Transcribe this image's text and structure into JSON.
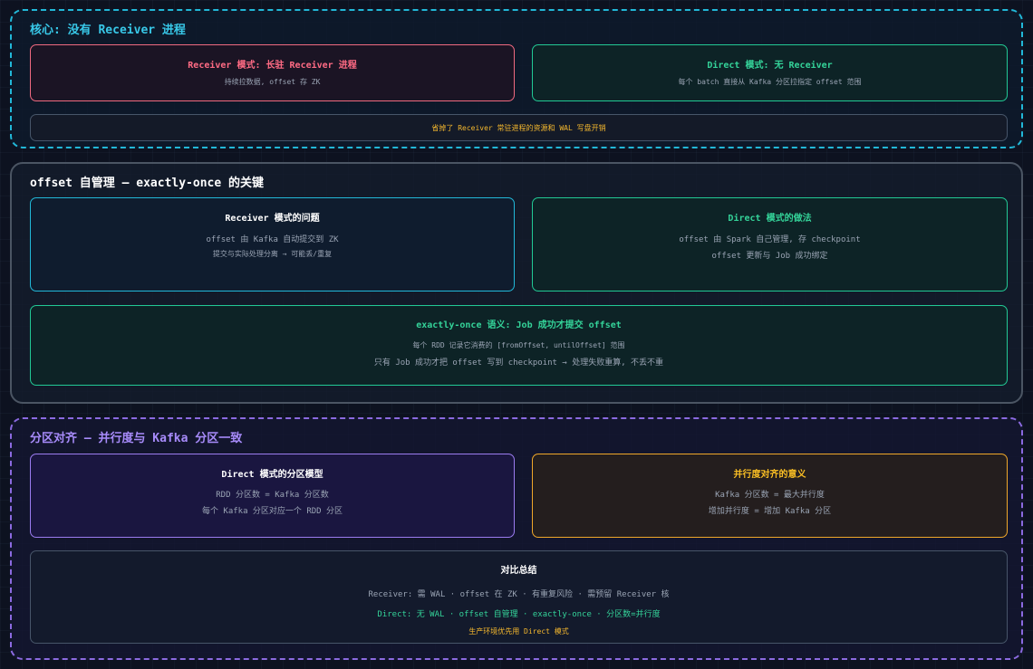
{
  "s1": {
    "title": "核心: 没有 Receiver 进程",
    "left": {
      "title": "Receiver 模式: 长驻 Receiver 进程",
      "line1": "持续拉数据, offset 存 ZK"
    },
    "right": {
      "title": "Direct 模式: 无 Receiver",
      "line1": "每个 batch 直接从 Kafka 分区拉指定 offset 范围"
    },
    "note": "省掉了 Receiver 常驻进程的资源和 WAL 写盘开销"
  },
  "s2": {
    "title": "offset 自管理 — exactly-once 的关键",
    "left": {
      "title": "Receiver 模式的问题",
      "line1": "offset 由 Kafka 自动提交到 ZK",
      "line2": "提交与实际处理分离 → 可能丢/重复"
    },
    "right": {
      "title": "Direct 模式的做法",
      "line1": "offset 由 Spark 自己管理, 存 checkpoint",
      "line2": "offset 更新与 Job 成功绑定"
    },
    "wide": {
      "title": "exactly-once 语义: Job 成功才提交 offset",
      "line1": "每个 RDD 记录它消费的 [fromOffset, untilOffset] 范围",
      "line2": "只有 Job 成功才把 offset 写到 checkpoint → 处理失败重算, 不丢不重"
    }
  },
  "s3": {
    "title": "分区对齐 — 并行度与 Kafka 分区一致",
    "left": {
      "title": "Direct 模式的分区模型",
      "line1": "RDD 分区数 = Kafka 分区数",
      "line2": "每个 Kafka 分区对应一个 RDD 分区"
    },
    "right": {
      "title": "并行度对齐的意义",
      "line1": "Kafka 分区数 = 最大并行度",
      "line2": "增加并行度 = 增加 Kafka 分区"
    },
    "summary": {
      "title": "对比总结",
      "receiver": "Receiver: 需 WAL · offset 在 ZK · 有重复风险 · 需预留 Receiver 核",
      "direct": "Direct: 无 WAL · offset 自管理 · exactly-once · 分区数=并行度",
      "note": "生产环境优先用 Direct 模式"
    }
  },
  "colors": {
    "cyan": "#22b8d8",
    "red": "#f06a80",
    "green": "#22c995",
    "purple": "#9b7cf0",
    "orange": "#f0a82a",
    "grey": "#475569"
  }
}
